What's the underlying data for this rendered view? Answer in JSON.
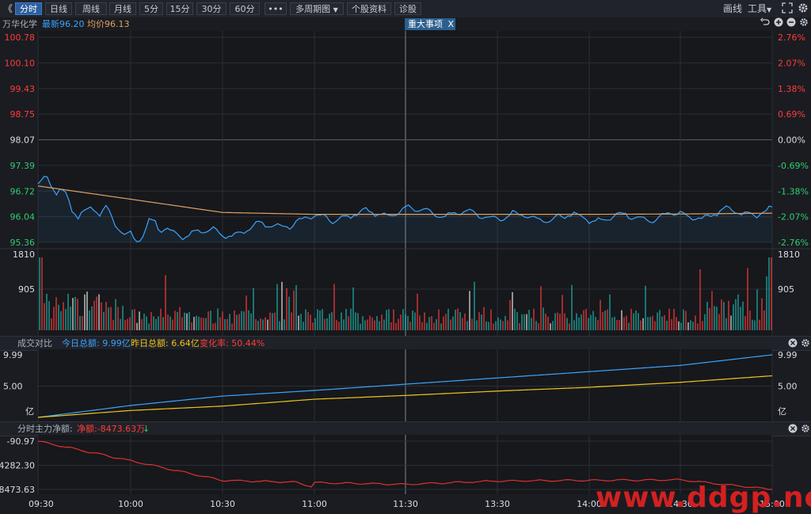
{
  "toolbar": {
    "collapse_icon": "double-chevron-left-icon",
    "tabs": [
      "分时",
      "日线",
      "周线",
      "月线",
      "5分",
      "15分",
      "30分",
      "60分"
    ],
    "more": "•••",
    "multi_period": "多周期图",
    "profile": "个股资料",
    "diagnose": "诊股",
    "draw_line": "画线",
    "tools": "工具"
  },
  "info": {
    "stock": "万华化学",
    "latest": "最新96.20",
    "avg": "均价96.13",
    "event": "重大事项",
    "event_close": "X"
  },
  "price_axis": {
    "left": [
      "100.78",
      "100.10",
      "99.43",
      "98.75",
      "98.07",
      "97.39",
      "96.72",
      "96.04",
      "95.36"
    ],
    "right": [
      "2.76%",
      "2.07%",
      "1.38%",
      "0.69%",
      "0.00%",
      "-0.69%",
      "-1.38%",
      "-2.07%",
      "-2.76%"
    ]
  },
  "volume_axis": {
    "max": "1810",
    "mid": "905"
  },
  "turnover_panel": {
    "title": "成交对比",
    "today": "今日总额: 9.99亿",
    "yesterday": "昨日总额: 6.64亿",
    "change": "变化率: 50.44%",
    "top": "9.99",
    "mid": "5.00",
    "unit": "亿"
  },
  "flow_panel": {
    "title": "分时主力净额:",
    "net": "净额:-8473.63万",
    "arrow": "↓",
    "ticks": [
      "-90.97",
      "-4282.30",
      "-8473.63"
    ]
  },
  "time_axis": [
    "09:30",
    "10:00",
    "10:30",
    "11:00",
    "11:30",
    "13:30",
    "14:00",
    "14:30",
    "15:00"
  ],
  "watermark": "www.ddgp.net",
  "colors": {
    "up": "#ff3b3b",
    "down": "#2ecc71",
    "price_line": "#3aa4ff",
    "avg_line": "#e0a060",
    "today_line": "#3aa4ff",
    "yesterday_line": "#f0c419",
    "flow_line": "#e03030"
  },
  "chart_data": [
    {
      "type": "line",
      "title": "",
      "xlabel": "",
      "ylabel": "",
      "x": [
        "09:30",
        "10:00",
        "10:30",
        "11:00",
        "11:30",
        "13:30",
        "14:00",
        "14:30",
        "15:00"
      ],
      "series": [
        {
          "name": "最新",
          "values": [
            96.88,
            95.65,
            95.6,
            95.98,
            96.2,
            96.05,
            96.0,
            96.05,
            96.2
          ]
        },
        {
          "name": "均价",
          "values": [
            96.85,
            96.5,
            96.15,
            96.1,
            96.1,
            96.1,
            96.1,
            96.11,
            96.13
          ]
        }
      ],
      "ylim": [
        95.36,
        100.78
      ],
      "prev_close": 98.07
    },
    {
      "type": "line",
      "title": "成交对比",
      "x": [
        "09:30",
        "10:00",
        "10:30",
        "11:00",
        "11:30",
        "13:30",
        "14:00",
        "14:30",
        "15:00"
      ],
      "series": [
        {
          "name": "今日总额",
          "values": [
            0,
            1.9,
            3.4,
            4.3,
            5.3,
            6.3,
            7.3,
            8.3,
            9.99
          ]
        },
        {
          "name": "昨日总额",
          "values": [
            0,
            1.1,
            1.8,
            2.9,
            3.5,
            4.2,
            4.8,
            5.6,
            6.64
          ]
        }
      ],
      "ylim": [
        0,
        9.99
      ]
    },
    {
      "type": "line",
      "title": "分时主力净额:",
      "x": [
        "09:30",
        "10:00",
        "10:30",
        "11:00",
        "11:30",
        "13:30",
        "14:00",
        "14:30",
        "15:00"
      ],
      "series": [
        {
          "name": "净额",
          "values": [
            -90.97,
            -3500,
            -6900,
            -7300,
            -7600,
            -7000,
            -6900,
            -6800,
            -8473.63
          ]
        }
      ],
      "ylim": [
        -8473.63,
        -90.97
      ]
    }
  ]
}
